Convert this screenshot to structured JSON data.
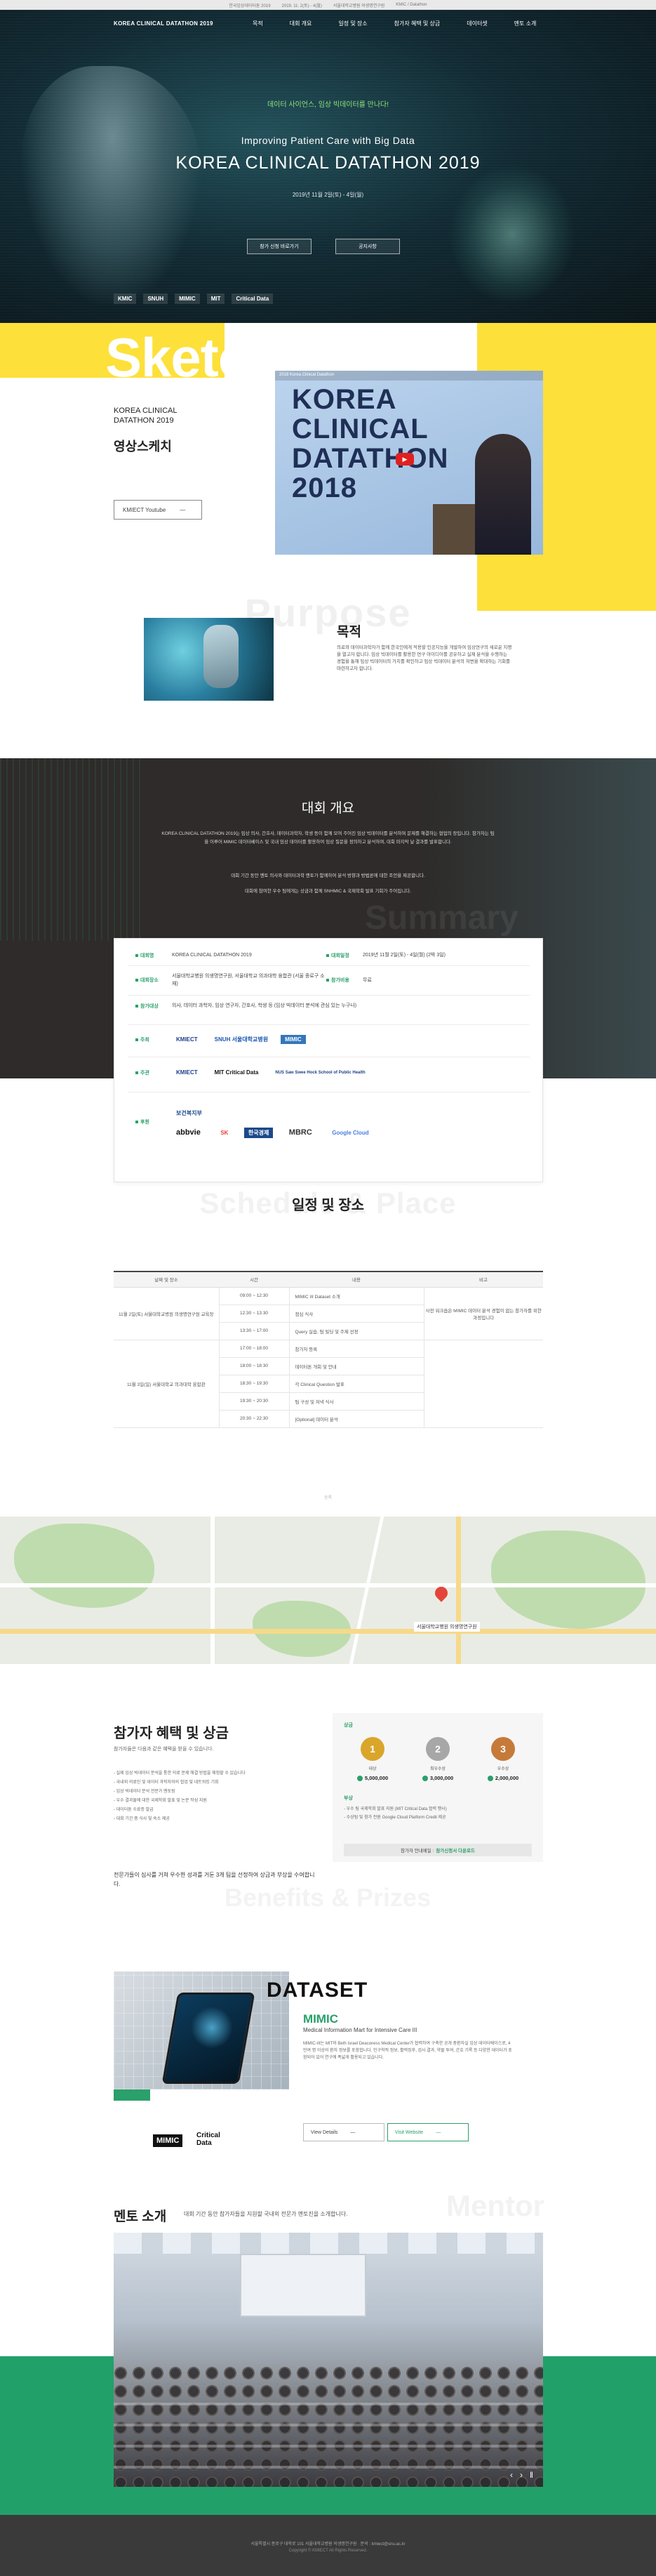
{
  "topbar": {
    "items": [
      "한국임상데이터톤 2019",
      "2019. 11. 2(토) - 4(월)",
      "서울대학교병원 의생명연구원",
      "KMIC / Datathon"
    ]
  },
  "nav": {
    "logo": "KOREA CLINICAL DATATHON 2019",
    "menu": [
      "목적",
      "대회 개요",
      "일정 및 장소",
      "참가자 혜택 및 상금",
      "데이터셋",
      "멘토 소개"
    ]
  },
  "hero": {
    "tagline": "데이터 사이언스, 임상 빅데이터를 만나다!",
    "subtitle": "Improving Patient Care with Big Data",
    "title": "KOREA CLINICAL DATATHON 2019",
    "date": "2019년 11월 2일(토) - 4일(월)",
    "btn_register": "참가 신청 바로가기",
    "btn_notice": "공지사항",
    "logos": [
      "KMIC",
      "SNUH",
      "MIMIC",
      "MIT",
      "Critical Data"
    ]
  },
  "sketch": {
    "word": "Sketch",
    "sub_line1": "KOREA CLINICAL",
    "sub_line2": "DATATHON 2019",
    "title": "영상스케치",
    "btn_label": "KMIECT Youtube",
    "btn_arrow": "—",
    "video_text_line1": "KOREA",
    "video_text_line2": "CLINICAL",
    "video_text_line3": "DATATHON",
    "video_text_line4": "2018",
    "video_bar": "2018 Korea Clinical Datathon",
    "video_play": "▶"
  },
  "purpose": {
    "bg_word": "Purpose",
    "title": "목적",
    "text": "의료와 데이터과학자가 함께 한국인에게 적용할 인공지능을 개발하여 임상연구의 새로운 지평을 열고자 합니다. 임상 빅데이터를 활용한 연구 아이디어를 공유하고 실제 분석을 수행하는 경험을 통해 임상 빅데이터의 가치를 확인하고 임상 빅데이터 분석의 저변을 확대하는 기회를 마련하고자 합니다."
  },
  "summary": {
    "title": "대회 개요",
    "p1": "KOREA CLINICAL DATATHON 2019는 임상 의사, 간호사, 데이터과학자, 학생 등이 함께 모여 주어진 임상 빅데이터를 분석하며 문제를 해결하는 협업의 장입니다. 참가자는 팀을 이루어 MIMIC 데이터베이스 및 국내 임상 데이터를 활용하여 임상 질문을 정의하고 분석하며, 대회 마지막 날 결과를 발표합니다.",
    "p2": "대회 기간 동안 멘토 의사와 데이터과학 멘토가 함께하여 분석 방향과 방법론에 대한 조언을 제공합니다.",
    "p3": "대회에 참여한 우수 팀에게는 상금과 함께 SNHMIC & 국제학회 발표 기회가 주어집니다.",
    "bg_word": "Summary"
  },
  "info": {
    "rows": [
      {
        "label": "대회명",
        "value": "KOREA CLINICAL DATATHON 2019",
        "label2": "대회일정",
        "value2": "2019년 11월 2일(토) - 4일(월) (2박 3일)"
      },
      {
        "label": "대회장소",
        "value": "서울대학교병원 의생명연구원, 서울대학교 의과대학 융합관 (서울 종로구 소재)",
        "label2": "참가비용",
        "value2": "무료"
      },
      {
        "label": "참가대상",
        "value": "의사, 데이터 과학자, 임상 연구자, 간호사, 학생 등 (임상 빅데이터 분석에 관심 있는 누구나)"
      }
    ],
    "host_label": "주최",
    "host_logos": [
      "KMIECT",
      "SNUH 서울대학교병원",
      "MIMIC"
    ],
    "org_label": "주관",
    "org_logos": [
      "KMIECT",
      "MIT Critical Data",
      "NUS Saw Swee Hock School of Public Health"
    ],
    "sponsor_label": "후원",
    "sponsor_logos": [
      "보건복지부",
      "abbvie",
      "SK",
      "한국경제",
      "MBRC",
      "Google Cloud"
    ]
  },
  "schedule": {
    "bg_word": "Schedule & Place",
    "title": "일정 및 장소",
    "headers": [
      "날짜 및 장소",
      "시간",
      "내용",
      "비고"
    ],
    "day1_place": "11월 2일(토) 서울대학교병원 의생명연구원 교육장",
    "day1_rows": [
      {
        "time": "09:00 ~ 12:30",
        "content": "MIMIC III Dataset 소개"
      },
      {
        "time": "12:30 ~ 13:30",
        "content": "점심 식사"
      },
      {
        "time": "13:30 ~ 17:00",
        "content": "Query 실습, 팀 빌딩 및 주제 선정"
      }
    ],
    "day1_note": "사전 워크숍은 MIMIC 데이터 분석 경험이 없는 참가자를 위한 과정입니다",
    "day2_place": "11월 3일(일) 서울대학교 의과대학 융합관",
    "day2_rows": [
      {
        "time": "17:00 ~ 18:00",
        "content": "참가자 등록"
      },
      {
        "time": "18:00 ~ 18:30",
        "content": "데이터톤 개회 및 안내"
      },
      {
        "time": "18:30 ~ 19:30",
        "content": "각 Clinical Question 발표"
      },
      {
        "time": "19:30 ~ 20:30",
        "content": "팀 구성 및 저녁 식사"
      },
      {
        "time": "20:30 ~ 22:30",
        "content": "[Optional] 데이터 분석"
      }
    ],
    "foot": "등록"
  },
  "map": {
    "label": "서울대학교병원 의생명연구원"
  },
  "benefits": {
    "title": "참가자 혜택 및 상금",
    "sub": "참가자들은 다음과 같은 혜택을 받을 수 있습니다.",
    "list": [
      "- 실제 임상 빅데이터 분석을 통한 의료 문제 해결 방법을 체험할 수 있습니다",
      "- 국내외 의료인 및 데이터 과학자와의 협업 및 네트워킹 기회",
      "- 임상 빅데이터 분석 전문가 멘토링",
      "- 우수 결과물에 대한 국제학회 발표 및 논문 작성 지원",
      "- 데이터톤 수료증 발급",
      "- 대회 기간 중 식사 및 숙소 제공"
    ],
    "note": "전문가들이 심사를 거쳐 우수한 성과를 거둔 3개 팀을 선정하여 상금과 부상을 수여합니다.",
    "bg_word": "Benefits & Prizes",
    "prize_head": "상금",
    "prizes": [
      {
        "rank": "1",
        "label": "대상",
        "amount": "5,000,000"
      },
      {
        "rank": "2",
        "label": "최우수상",
        "amount": "3,000,000"
      },
      {
        "rank": "3",
        "label": "우수상",
        "amount": "2,000,000"
      }
    ],
    "extra_head": "부상",
    "extra_lines": [
      "- 우수 팀 국제학회 발표 지원 (MIT Critical Data 협력 행사)",
      "- 수상팀 및 참가 전원 Google Cloud Platform Credit 제공"
    ],
    "btn_prefix": "참가자 안내메일 :",
    "btn_link": "참가신청서 다운로드"
  },
  "dataset": {
    "title": "DATASET",
    "mimic": "MIMIC",
    "mimic_sub": "Medical Information Mart for Intensive Care III",
    "text": "MIMIC-III는 MIT와 Beth Israel Deaconess Medical Center가 협력하여 구축한 공개 중환자실 임상 데이터베이스로, 4만여 명 이상의 환자 정보를 포함합니다. 인구학적 정보, 활력징후, 검사 결과, 약물 투여, 간호 기록 등 다양한 데이터가 포함되어 있어 연구에 폭넓게 활용되고 있습니다.",
    "btn_details": "View Details",
    "btn_website": "Visit Website",
    "btn_arrow": "—",
    "logo_mimic": "MIMIC",
    "logo_cd_1": "Critical",
    "logo_cd_2": "Data"
  },
  "mentor": {
    "title": "멘토 소개",
    "text": "대회 기간 동안 참가자들을 지원할 국내외 전문가 멘토진을 소개합니다.",
    "bg_word": "Mentor",
    "nav_prev": "‹",
    "nav_next": "›",
    "nav_pause": "‖"
  },
  "footer": {
    "line1": "서울특별시 종로구 대학로 101 서울대학교병원 의생명연구원 · 문의 : kmiect@snu.ac.kr",
    "line2": "Copyright © KMIECT All Rights Reserved."
  },
  "colors": {
    "accent_green": "#2aa06a",
    "accent_yellow": "#fde03a",
    "dark": "#2e2b2a"
  }
}
